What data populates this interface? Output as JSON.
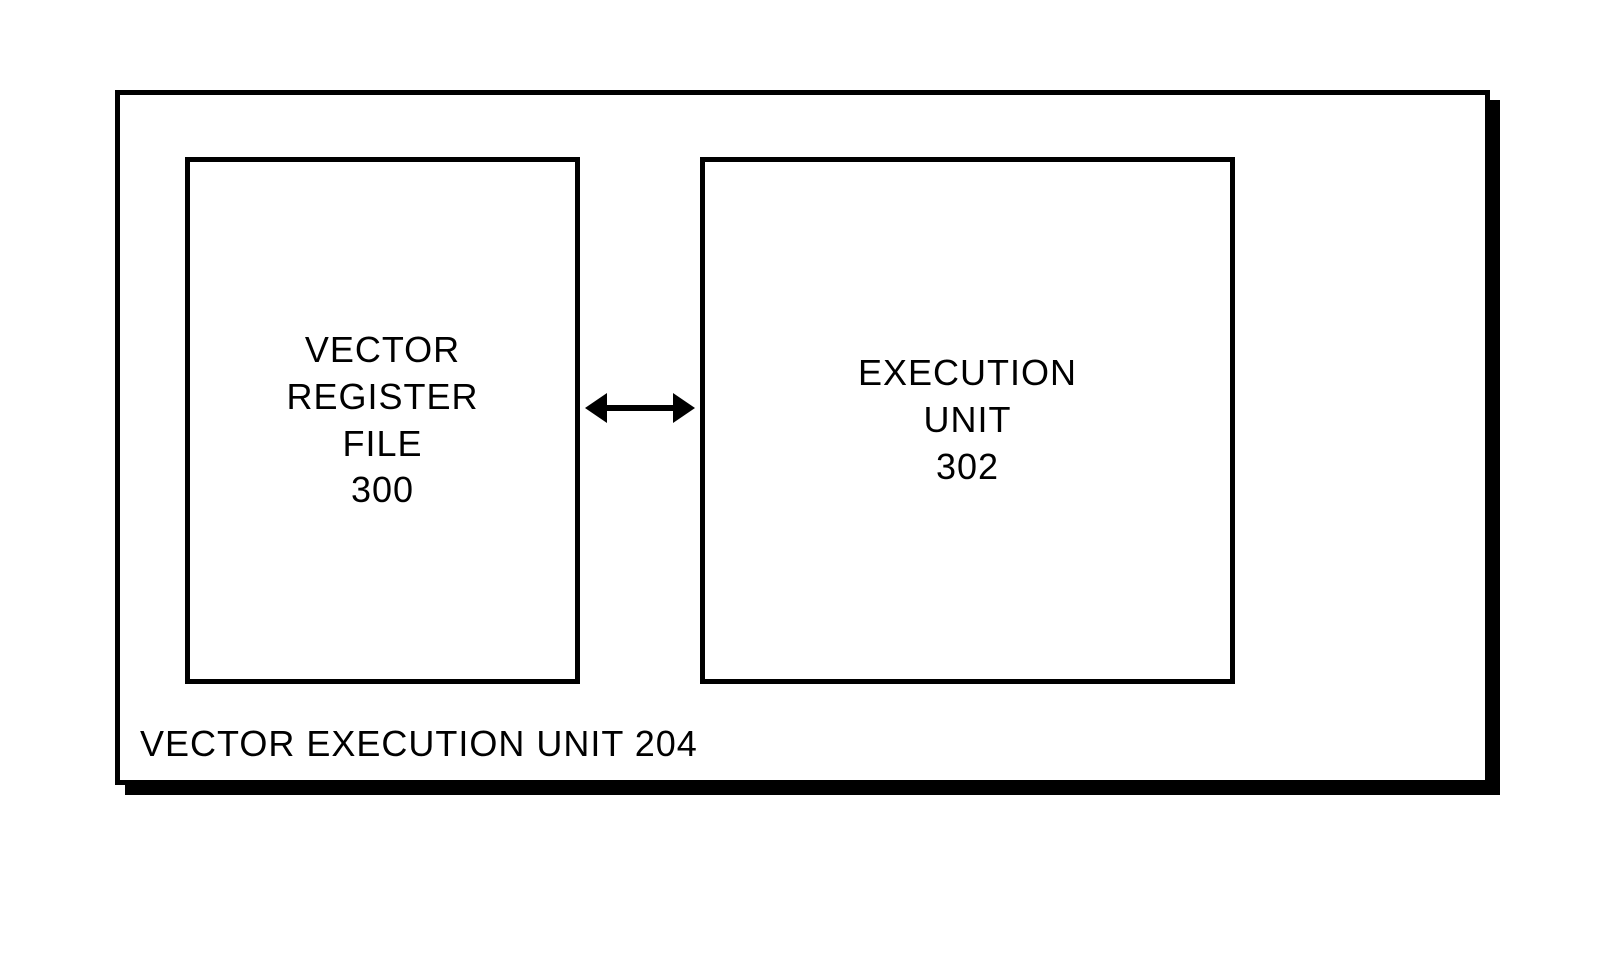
{
  "outer": {
    "label_prefix": "VECTOR EXECUTION UNIT",
    "number": "204"
  },
  "left_box": {
    "line1": "VECTOR",
    "line2": "REGISTER",
    "line3": "FILE",
    "number": "300"
  },
  "right_box": {
    "line1": "EXECUTION",
    "line2": "UNIT",
    "number": "302"
  }
}
